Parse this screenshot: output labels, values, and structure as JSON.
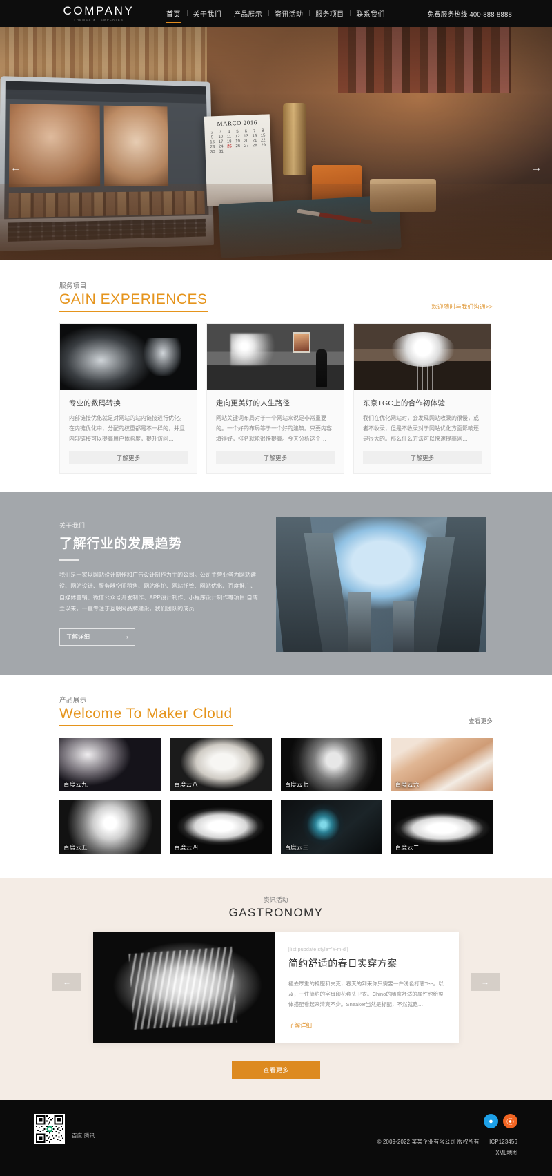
{
  "header": {
    "logo_main": "COMPANY",
    "logo_sub": "THEMES & TEMPLATES",
    "nav": [
      {
        "label": "首页",
        "active": true
      },
      {
        "label": "关于我们",
        "active": false
      },
      {
        "label": "产品展示",
        "active": false
      },
      {
        "label": "资讯活动",
        "active": false
      },
      {
        "label": "服务项目",
        "active": false
      },
      {
        "label": "联系我们",
        "active": false
      }
    ],
    "hotline": "免费服务热线 400-888-8888"
  },
  "hero": {
    "prev_icon": "arrow-left-icon",
    "next_icon": "arrow-right-icon",
    "calendar_title": "MARÇO 2016",
    "calendar_days": [
      "2",
      "3",
      "4",
      "5",
      "6",
      "7",
      "8",
      "9",
      "10",
      "11",
      "12",
      "13",
      "14",
      "15",
      "16",
      "17",
      "18",
      "19",
      "20",
      "21",
      "22",
      "23",
      "24",
      "25",
      "26",
      "27",
      "28",
      "29",
      "30",
      "31"
    ],
    "calendar_highlight": "25"
  },
  "services": {
    "kicker": "服务项目",
    "title": "GAIN EXPERIENCES",
    "link": "欢迎随时与我们沟通>>",
    "cards": [
      {
        "title": "专业的数码转换",
        "desc": "内部链接优化就是对网站的站内链接进行优化。在内链优化中，分配的权重都是不一样的，并且内部链接可以提高用户体验度，提升访问…",
        "button": "了解更多"
      },
      {
        "title": "走向更美好的人生路径",
        "desc": "网站关键词布局对于一个网站来说是非常重要的。一个好的布局等于一个好的建筑。只要内容填得好，排名就能很快提高。今天分析这个…",
        "button": "了解更多"
      },
      {
        "title": "东京TGC上的合作初体验",
        "desc": "我们在优化网站时，会发现网站收录的很慢，或者不收录，但是不收录对于网站优化方面影响还是很大的。那么什么方法可以快速提高网…",
        "button": "了解更多"
      }
    ]
  },
  "about": {
    "kicker": "关于我们",
    "title": "了解行业的发展趋势",
    "text": "我们是一家以网站设计制作和广告设计制作为主的公司。公司主营业务为网站建设、网站设计、服务器空间租售、网站维护、网站托管、网站优化、百度推广、自媒体营销、微信公众号开发制作、APP设计制作、小程序设计制作等项目;自成立以来，一直专注于互联网品牌建设，我们团队的成员…",
    "button": "了解详细",
    "button_icon": "chevron-right-icon"
  },
  "products": {
    "kicker": "产品展示",
    "title": "Welcome To Maker Cloud",
    "link": "查看更多",
    "items": [
      {
        "label": "百度云九"
      },
      {
        "label": "百度云八"
      },
      {
        "label": "百度云七"
      },
      {
        "label": "百度云六"
      },
      {
        "label": "百度云五"
      },
      {
        "label": "百度云四"
      },
      {
        "label": "百度云三"
      },
      {
        "label": "百度云二"
      }
    ]
  },
  "news": {
    "kicker": "资讯活动",
    "title": "GASTRONOMY",
    "prev_icon": "arrow-left-icon",
    "next_icon": "arrow-right-icon",
    "item": {
      "date": "[list:pubdate style='Y-m-d']",
      "title": "简约舒适的春日实穿方案",
      "text": "褪去厚重的棉服和夹克，春天的到来你只需要一件浅色打底Tee。以及，一件简约的字母印花套头卫衣。Chino的随意舒适的属性也给整体搭配看起来清爽不少。Sneaker当然是标配，不然就跑…",
      "more": "了解详细"
    },
    "button": "查看更多"
  },
  "footer": {
    "qr_caption": "百度 腾讯",
    "social": [
      {
        "name": "qq-icon",
        "glyph": "🐧"
      },
      {
        "name": "weibo-icon",
        "glyph": "◉"
      }
    ],
    "copyright": "© 2009-2022 某某企业有限公司 版权所有",
    "icp": "ICP123456",
    "sitemap": "XML地图"
  },
  "colors": {
    "accent": "#e5941c",
    "accent_button": "#dd8a20",
    "dark": "#0b0b0b",
    "about_bg": "#a3a7ab",
    "news_bg": "#f4ece5"
  }
}
